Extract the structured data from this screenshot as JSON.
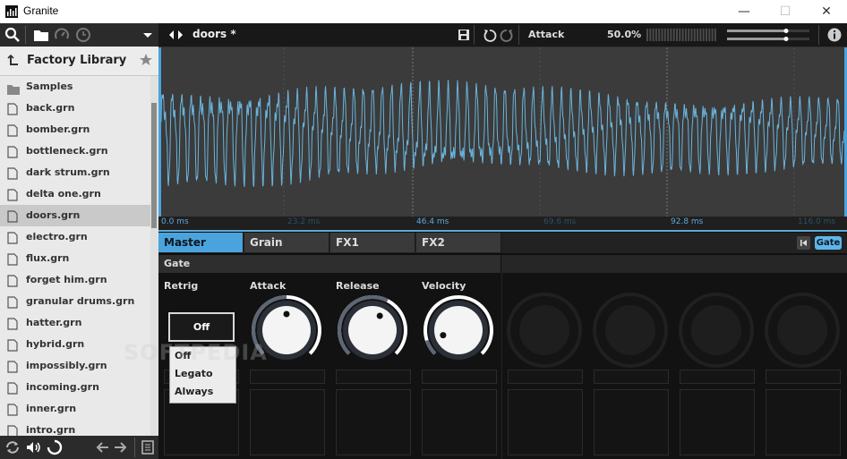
{
  "window": {
    "title": "Granite",
    "minimize": "—",
    "maximize": "☐",
    "close": "✕"
  },
  "library": {
    "title": "Factory Library",
    "folder": "Samples",
    "files": [
      "back.grn",
      "bomber.grn",
      "bottleneck.grn",
      "dark strum.grn",
      "delta one.grn",
      "doors.grn",
      "electro.grn",
      "flux.grn",
      "forget him.grn",
      "granular drums.grn",
      "hatter.grn",
      "hybrid.grn",
      "impossibly.grn",
      "incoming.grn",
      "inner.grn",
      "intro.grn"
    ],
    "selected_index": 5
  },
  "topbar": {
    "patch_name": "doors *",
    "param_name": "Attack",
    "param_value": "50.0%"
  },
  "timeline": {
    "labels": [
      "0.0 ms",
      "23.2 ms",
      "46.4 ms",
      "69.6 ms",
      "92.8 ms",
      "116.0 ms"
    ]
  },
  "tabs": [
    "Master",
    "Grain",
    "FX1",
    "FX2"
  ],
  "gate_button": "Gate",
  "section": {
    "label": "Gate"
  },
  "controls": {
    "retrig_label": "Retrig",
    "attack_label": "Attack",
    "release_label": "Release",
    "velocity_label": "Velocity",
    "retrig_value": "Off",
    "retrig_options": [
      "Off",
      "Legato",
      "Always"
    ],
    "attack_value": 0.5,
    "release_value": 0.6,
    "velocity_value": 0.1
  },
  "watermark": "SOFTPEDIA",
  "colors": {
    "accent": "#4aa3dd",
    "waveform": "#6ab4dc",
    "background": "#0f0f0f"
  }
}
